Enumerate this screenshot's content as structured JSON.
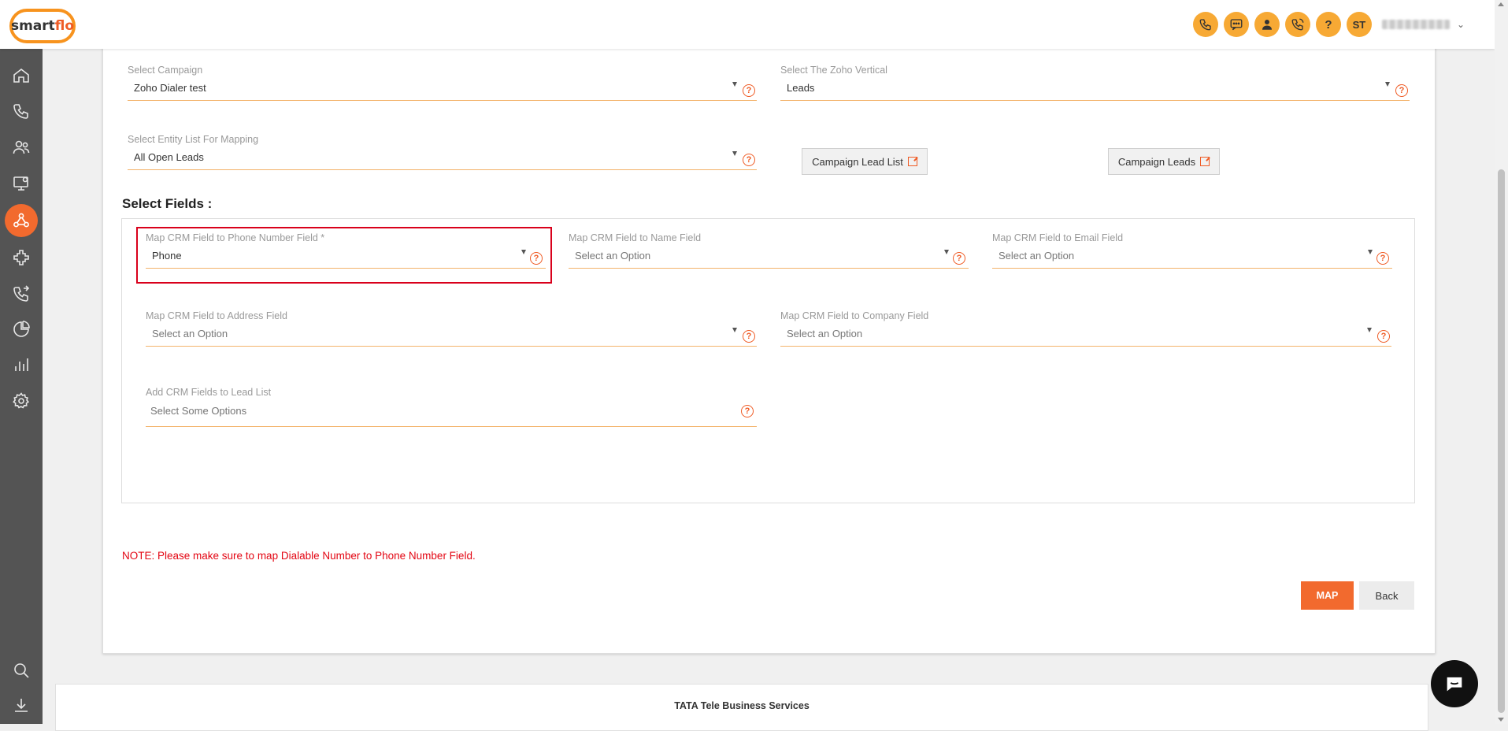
{
  "header": {
    "logo_text_a": "smart",
    "logo_text_b": "flo",
    "user_initials": "ST",
    "user_name": "",
    "icons": [
      "phone-icon",
      "sms-icon",
      "agent-icon",
      "call-monitor-icon",
      "help-icon"
    ]
  },
  "sidebar": {
    "items": [
      "home-icon",
      "phone-icon",
      "users-icon",
      "monitor-icon",
      "integrations-icon",
      "plugins-icon",
      "call-transfer-icon",
      "pie-chart-icon",
      "bar-chart-icon",
      "settings-icon",
      "search-icon",
      "download-icon"
    ],
    "active": "integrations-icon"
  },
  "form": {
    "campaign": {
      "label": "Select Campaign",
      "value": "Zoho Dialer test"
    },
    "vertical": {
      "label": "Select The Zoho Vertical",
      "value": "Leads"
    },
    "entity_list": {
      "label": "Select Entity List For Mapping",
      "value": "All Open Leads"
    },
    "campaign_lead_list_btn": "Campaign Lead List",
    "campaign_leads_btn": "Campaign Leads",
    "section_title": "Select Fields :",
    "phone_field": {
      "label": "Map CRM Field to Phone Number Field *",
      "value": "Phone"
    },
    "name_field": {
      "label": "Map CRM Field to Name Field",
      "value": "Select an Option"
    },
    "email_field": {
      "label": "Map CRM Field to Email Field",
      "value": "Select an Option"
    },
    "address_field": {
      "label": "Map CRM Field to Address Field",
      "value": "Select an Option"
    },
    "company_field": {
      "label": "Map CRM Field to Company Field",
      "value": "Select an Option"
    },
    "lead_list_fields": {
      "label": "Add CRM Fields to Lead List",
      "placeholder": "Select Some Options"
    },
    "help_glyph": "?",
    "note": "NOTE: Please make sure to map Dialable Number to Phone Number Field.",
    "map_btn": "MAP",
    "back_btn": "Back"
  },
  "footer": {
    "text": "TATA Tele Business Services"
  },
  "colors": {
    "accent": "#f26a2e",
    "header_icon_bg": "#f7a934",
    "sidebar_bg": "#545454",
    "note_red": "#e30613"
  }
}
